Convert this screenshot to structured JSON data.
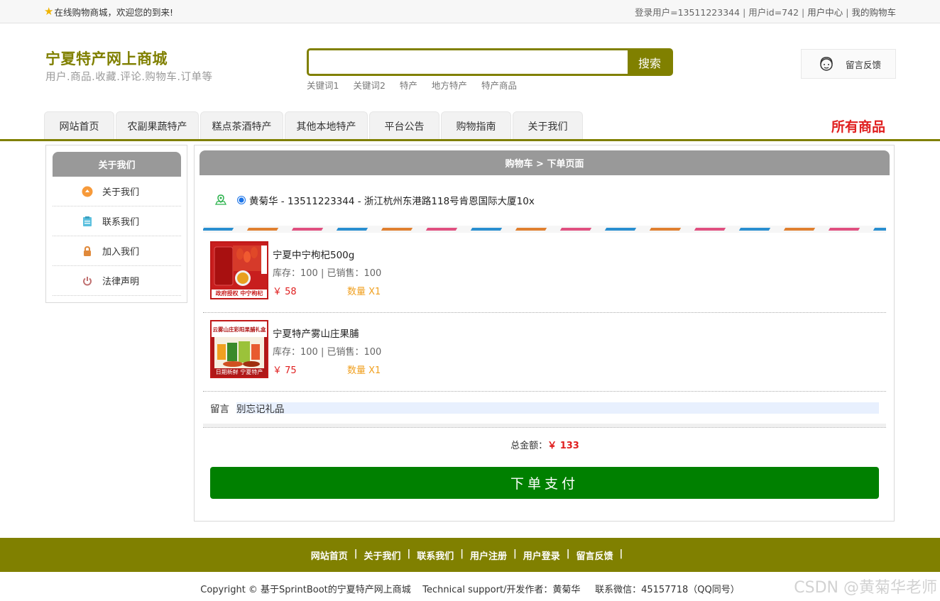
{
  "topbar": {
    "welcome": "在线购物商城，欢迎您的到来!",
    "login_user": "登录用户=13511223344",
    "user_id": "用户id=742",
    "user_center": "用户中心",
    "my_cart": "我的购物车"
  },
  "header": {
    "site_title": "宁夏特产网上商城",
    "site_subtitle": "用户.商品.收藏.评论.购物车.订单等",
    "search": {
      "placeholder": "",
      "button_label": "搜索"
    },
    "hot_words": [
      "关键词1",
      "关键词2",
      "特产",
      "地方特产",
      "特产商品"
    ],
    "feedback_label": "留言反馈"
  },
  "nav": {
    "tabs": [
      {
        "label": "网站首页",
        "width": 99
      },
      {
        "label": "农副果蔬特产",
        "width": 117
      },
      {
        "label": "糕点茶酒特产",
        "width": 117
      },
      {
        "label": "其他本地特产",
        "width": 117
      },
      {
        "label": "平台公告",
        "width": 99
      },
      {
        "label": "购物指南",
        "width": 99
      },
      {
        "label": "关于我们",
        "width": 99
      }
    ],
    "all_goods": "所有商品"
  },
  "sidebar": {
    "title": "关于我们",
    "items": [
      {
        "label": "关于我们",
        "icon": "about-icon"
      },
      {
        "label": "联系我们",
        "icon": "contact-icon"
      },
      {
        "label": "加入我们",
        "icon": "join-icon"
      },
      {
        "label": "法律声明",
        "icon": "legal-icon"
      }
    ]
  },
  "order": {
    "breadcrumb": "购物车 > 下单页面",
    "address": "黄菊华 - 13511223344 - 浙江杭州东港路118号肯恩国际大厦10x",
    "products": [
      {
        "name": "宁夏中宁枸杞500g",
        "stock_sales": "库存：100 | 已销售：100",
        "price": "￥ 58",
        "qty": "数量 X1",
        "img_caption": "政府授权 中宁枸杞"
      },
      {
        "name": "宁夏特产雾山庄果脯",
        "stock_sales": "库存：100 | 已销售：100",
        "price": "￥ 75",
        "qty": "数量 X1",
        "img_caption": "日期新鲜 宁夏特产",
        "img_top": "云雾山庄彩阳果脯礼盒"
      }
    ],
    "memo_label": "留言",
    "memo_value": "别忘记礼品",
    "total_label": "总金额：",
    "total_amount": "￥ 133",
    "pay_button": "下单支付"
  },
  "footer": {
    "links": [
      "网站首页",
      "关于我们",
      "联系我们",
      "用户注册",
      "用户登录",
      "留言反馈"
    ],
    "copyright": "Copyright © 基于SprintBoot的宁夏特产网上商城    Technical support/开发作者：黄菊华     联系微信：45157718（QQ同号）",
    "watermark": "CSDN @黄菊华老师"
  },
  "colors": {
    "brand": "#808000",
    "pay": "#008000",
    "price": "#e02020",
    "qty": "#f0a020"
  }
}
